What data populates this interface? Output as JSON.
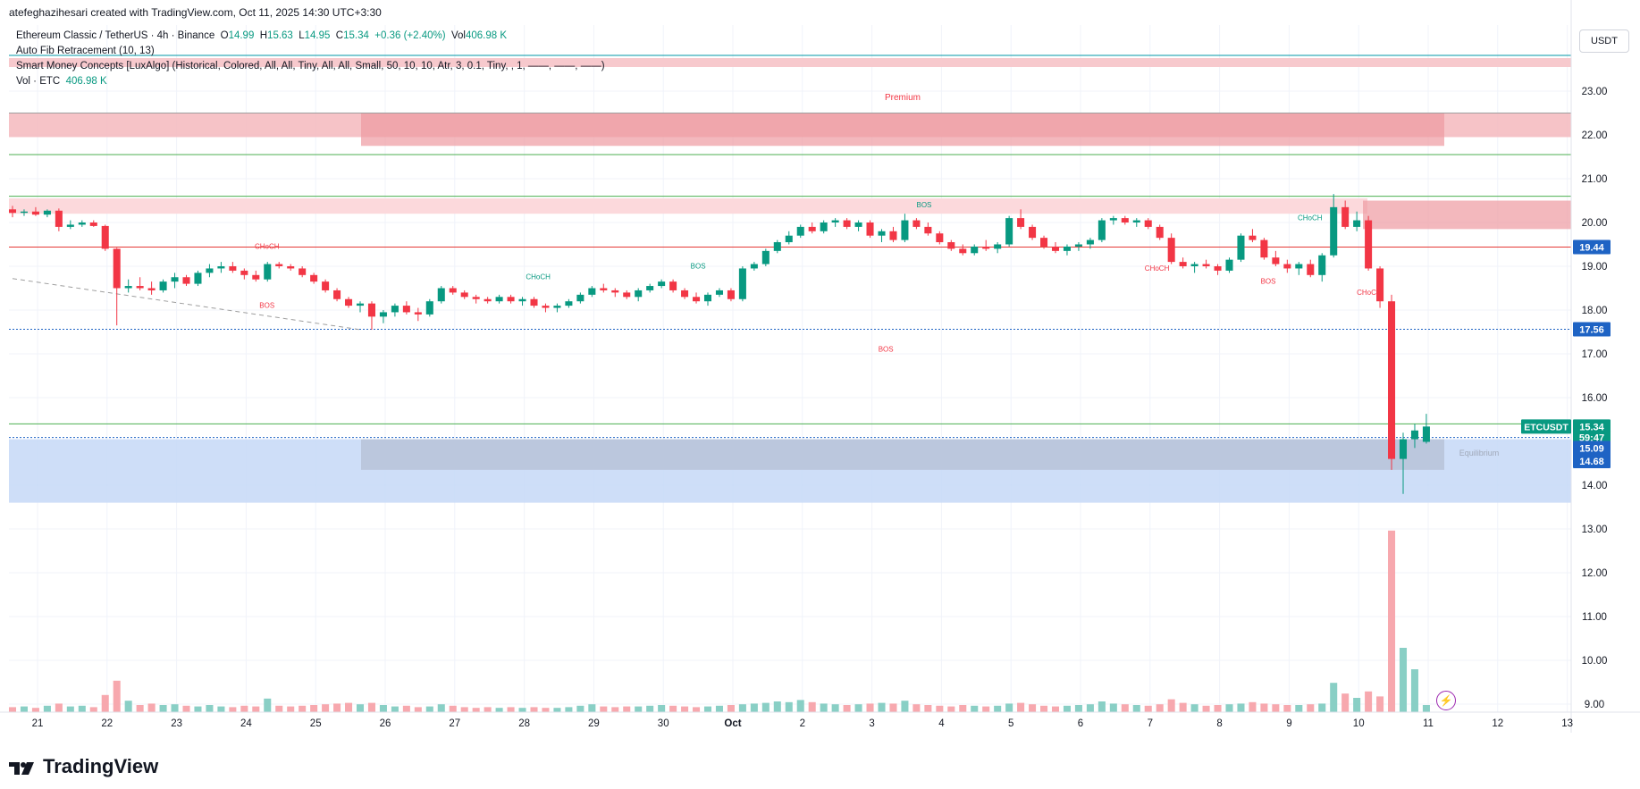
{
  "header": {
    "caption": "atefeghazihesari created with TradingView.com, Oct 11, 2025 14:30 UTC+3:30"
  },
  "legend": {
    "symbol_line": "Ethereum Classic / TetherUS · 4h · Binance",
    "o_label": "O",
    "o_value": "14.99",
    "h_label": "H",
    "h_value": "15.63",
    "l_label": "L",
    "l_value": "14.95",
    "c_label": "C",
    "c_value": "15.34",
    "change": "+0.36 (+2.40%)",
    "vol_label": "Vol",
    "vol_value": "406.98 K",
    "indicator1": "Auto Fib Retracement (10, 13)",
    "indicator2": "Smart Money Concepts [LuxAlgo] (Historical, Colored, All, All, Tiny, All, All, Small, 50, 10, 10, Atr, 3, 0.1, Tiny, , 1, ——, ——, ——)",
    "indicator3_label": "Vol · ETC",
    "indicator3_value": "406.98 K"
  },
  "currency": "USDT",
  "brand": "TradingView",
  "colors": {
    "up": "#089981",
    "down": "#f23645",
    "up_volume": "#89cfc5",
    "down_volume": "#f7a8ae",
    "premium_zone": "#f4b8bd",
    "discount_zone": "#c6d8f7",
    "fib_line": "#0097a7",
    "fib_green": "#4caf50",
    "fib_red": "#e53935",
    "fib_blue": "#1e63c4"
  },
  "chart_data": {
    "type": "candlestick",
    "symbol": "ETCUSDT",
    "timeframe": "4h",
    "y_ticks": [
      "23.00",
      "22.00",
      "21.00",
      "20.00",
      "19.00",
      "18.00",
      "17.00",
      "16.00",
      "15.00",
      "14.00",
      "13.00",
      "12.00",
      "11.00",
      "10.00",
      "9.00"
    ],
    "ylim": [
      8.75,
      24.0
    ],
    "x_ticks": [
      "21",
      "22",
      "23",
      "24",
      "25",
      "26",
      "27",
      "28",
      "29",
      "30",
      "Oct",
      "2",
      "3",
      "4",
      "5",
      "6",
      "7",
      "8",
      "9",
      "10",
      "11",
      "12",
      "13"
    ],
    "x_start": "Sep 21",
    "candles_per_day": 6,
    "price_labels": [
      {
        "text": "19.44",
        "value": 19.44,
        "color": "#1e63c4"
      },
      {
        "text": "17.56",
        "value": 17.56,
        "color": "#1e63c4"
      },
      {
        "text": "15.34",
        "value": 15.34,
        "color": "#089981"
      },
      {
        "text": "59:47",
        "value": 15.09,
        "color": "#089981"
      },
      {
        "text": "15.09",
        "value": 14.85,
        "color": "#1e63c4"
      },
      {
        "text": "14.68",
        "value": 14.55,
        "color": "#1e63c4"
      }
    ],
    "symbol_tag": "ETCUSDT",
    "zone_labels": [
      "Premium",
      "Equilibrium"
    ],
    "structure_labels": [
      {
        "text": "BOS",
        "color": "#089981",
        "x": 12.75,
        "y": 20.35
      },
      {
        "text": "BOS",
        "color": "#089981",
        "x": 9.5,
        "y": 18.95
      },
      {
        "text": "CHoCH",
        "color": "#089981",
        "x": 7.2,
        "y": 18.7
      },
      {
        "text": "CHoCH",
        "color": "#089981",
        "x": 18.3,
        "y": 20.05
      },
      {
        "text": "CHoCH",
        "color": "#f23645",
        "x": 16.1,
        "y": 18.9
      },
      {
        "text": "BOS",
        "color": "#f23645",
        "x": 17.7,
        "y": 18.6
      },
      {
        "text": "CHoCH",
        "color": "#f23645",
        "x": 19.15,
        "y": 18.35
      },
      {
        "text": "BOS",
        "color": "#f23645",
        "x": 12.2,
        "y": 17.05
      },
      {
        "text": "BOS",
        "color": "#f23645",
        "x": 3.3,
        "y": 18.05
      },
      {
        "text": "CHoCH",
        "color": "#f23645",
        "x": 3.3,
        "y": 19.4
      }
    ],
    "fib_levels": [
      {
        "value": 22.5,
        "color": "#9e9e9e"
      },
      {
        "value": 21.55,
        "color": "#4caf50"
      },
      {
        "value": 20.6,
        "color": "#4caf50"
      },
      {
        "value": 19.44,
        "color": "#e53935"
      },
      {
        "value": 17.56,
        "color": "#1e63c4"
      },
      {
        "value": 15.4,
        "color": "#4caf50"
      },
      {
        "value": 15.09,
        "color": "#1e63c4"
      }
    ],
    "ohlc": [
      [
        20.3,
        20.38,
        20.12,
        20.22
      ],
      [
        20.22,
        20.3,
        20.15,
        20.25
      ],
      [
        20.25,
        20.35,
        20.15,
        20.18
      ],
      [
        20.18,
        20.3,
        20.12,
        20.27
      ],
      [
        20.27,
        20.32,
        19.8,
        19.9
      ],
      [
        19.9,
        20.05,
        19.85,
        19.95
      ],
      [
        19.95,
        20.05,
        19.9,
        20.0
      ],
      [
        20.0,
        20.05,
        19.9,
        19.92
      ],
      [
        19.92,
        19.95,
        19.35,
        19.4
      ],
      [
        19.4,
        19.42,
        17.65,
        18.5
      ],
      [
        18.5,
        18.7,
        18.4,
        18.55
      ],
      [
        18.55,
        18.75,
        18.45,
        18.5
      ],
      [
        18.5,
        18.65,
        18.35,
        18.45
      ],
      [
        18.45,
        18.7,
        18.4,
        18.65
      ],
      [
        18.65,
        18.85,
        18.5,
        18.75
      ],
      [
        18.75,
        18.8,
        18.55,
        18.6
      ],
      [
        18.6,
        18.9,
        18.55,
        18.85
      ],
      [
        18.85,
        19.05,
        18.75,
        18.95
      ],
      [
        18.95,
        19.1,
        18.85,
        19.0
      ],
      [
        19.0,
        19.1,
        18.85,
        18.9
      ],
      [
        18.9,
        18.95,
        18.7,
        18.8
      ],
      [
        18.8,
        18.9,
        18.65,
        18.7
      ],
      [
        18.7,
        19.1,
        18.65,
        19.05
      ],
      [
        19.05,
        19.1,
        18.95,
        19.0
      ],
      [
        19.0,
        19.05,
        18.9,
        18.95
      ],
      [
        18.95,
        19.0,
        18.75,
        18.8
      ],
      [
        18.8,
        18.85,
        18.6,
        18.65
      ],
      [
        18.65,
        18.7,
        18.4,
        18.45
      ],
      [
        18.45,
        18.5,
        18.2,
        18.25
      ],
      [
        18.25,
        18.3,
        18.05,
        18.1
      ],
      [
        18.1,
        18.2,
        17.95,
        18.15
      ],
      [
        18.15,
        18.2,
        17.55,
        17.85
      ],
      [
        17.85,
        18.0,
        17.7,
        17.95
      ],
      [
        17.95,
        18.15,
        17.85,
        18.1
      ],
      [
        18.1,
        18.2,
        17.9,
        17.95
      ],
      [
        17.95,
        18.05,
        17.75,
        17.9
      ],
      [
        17.9,
        18.25,
        17.85,
        18.2
      ],
      [
        18.2,
        18.55,
        18.15,
        18.5
      ],
      [
        18.5,
        18.55,
        18.35,
        18.4
      ],
      [
        18.4,
        18.45,
        18.25,
        18.3
      ],
      [
        18.3,
        18.35,
        18.15,
        18.25
      ],
      [
        18.25,
        18.3,
        18.15,
        18.2
      ],
      [
        18.2,
        18.35,
        18.15,
        18.3
      ],
      [
        18.3,
        18.35,
        18.15,
        18.2
      ],
      [
        18.2,
        18.3,
        18.1,
        18.25
      ],
      [
        18.25,
        18.3,
        18.05,
        18.1
      ],
      [
        18.1,
        18.15,
        17.95,
        18.05
      ],
      [
        18.05,
        18.15,
        17.95,
        18.1
      ],
      [
        18.1,
        18.25,
        18.05,
        18.2
      ],
      [
        18.2,
        18.4,
        18.15,
        18.35
      ],
      [
        18.35,
        18.55,
        18.3,
        18.5
      ],
      [
        18.5,
        18.6,
        18.4,
        18.45
      ],
      [
        18.45,
        18.5,
        18.3,
        18.4
      ],
      [
        18.4,
        18.45,
        18.25,
        18.3
      ],
      [
        18.3,
        18.5,
        18.2,
        18.45
      ],
      [
        18.45,
        18.6,
        18.4,
        18.55
      ],
      [
        18.55,
        18.7,
        18.5,
        18.65
      ],
      [
        18.65,
        18.7,
        18.4,
        18.45
      ],
      [
        18.45,
        18.5,
        18.25,
        18.3
      ],
      [
        18.3,
        18.4,
        18.15,
        18.2
      ],
      [
        18.2,
        18.4,
        18.1,
        18.35
      ],
      [
        18.35,
        18.5,
        18.3,
        18.45
      ],
      [
        18.45,
        18.5,
        18.2,
        18.25
      ],
      [
        18.25,
        19.0,
        18.2,
        18.95
      ],
      [
        18.95,
        19.1,
        18.9,
        19.05
      ],
      [
        19.05,
        19.4,
        19.0,
        19.35
      ],
      [
        19.35,
        19.6,
        19.3,
        19.55
      ],
      [
        19.55,
        19.8,
        19.5,
        19.7
      ],
      [
        19.7,
        19.95,
        19.65,
        19.9
      ],
      [
        19.9,
        20.0,
        19.75,
        19.8
      ],
      [
        19.8,
        20.05,
        19.75,
        20.0
      ],
      [
        20.0,
        20.1,
        19.9,
        20.05
      ],
      [
        20.05,
        20.1,
        19.85,
        19.9
      ],
      [
        19.9,
        20.05,
        19.8,
        20.0
      ],
      [
        20.0,
        20.05,
        19.65,
        19.7
      ],
      [
        19.7,
        19.85,
        19.55,
        19.8
      ],
      [
        19.8,
        19.9,
        19.55,
        19.6
      ],
      [
        19.6,
        20.2,
        19.55,
        20.05
      ],
      [
        20.05,
        20.1,
        19.85,
        19.9
      ],
      [
        19.9,
        20.0,
        19.7,
        19.75
      ],
      [
        19.75,
        19.8,
        19.5,
        19.55
      ],
      [
        19.55,
        19.6,
        19.35,
        19.4
      ],
      [
        19.4,
        19.5,
        19.25,
        19.3
      ],
      [
        19.3,
        19.5,
        19.25,
        19.45
      ],
      [
        19.45,
        19.6,
        19.35,
        19.4
      ],
      [
        19.4,
        19.55,
        19.3,
        19.5
      ],
      [
        19.5,
        20.15,
        19.45,
        20.1
      ],
      [
        20.1,
        20.3,
        19.85,
        19.9
      ],
      [
        19.9,
        19.95,
        19.6,
        19.65
      ],
      [
        19.65,
        19.7,
        19.4,
        19.45
      ],
      [
        19.45,
        19.55,
        19.3,
        19.35
      ],
      [
        19.35,
        19.5,
        19.25,
        19.45
      ],
      [
        19.45,
        19.55,
        19.35,
        19.5
      ],
      [
        19.5,
        19.65,
        19.4,
        19.6
      ],
      [
        19.6,
        20.1,
        19.55,
        20.05
      ],
      [
        20.05,
        20.15,
        19.95,
        20.1
      ],
      [
        20.1,
        20.15,
        19.95,
        20.0
      ],
      [
        20.0,
        20.1,
        19.9,
        20.05
      ],
      [
        20.05,
        20.1,
        19.85,
        19.9
      ],
      [
        19.9,
        19.95,
        19.6,
        19.65
      ],
      [
        19.65,
        19.75,
        19.05,
        19.1
      ],
      [
        19.1,
        19.2,
        18.95,
        19.0
      ],
      [
        19.0,
        19.1,
        18.85,
        19.05
      ],
      [
        19.05,
        19.15,
        18.95,
        19.0
      ],
      [
        19.0,
        19.05,
        18.8,
        18.9
      ],
      [
        18.9,
        19.2,
        18.85,
        19.15
      ],
      [
        19.15,
        19.75,
        19.1,
        19.7
      ],
      [
        19.7,
        19.85,
        19.55,
        19.6
      ],
      [
        19.6,
        19.65,
        19.15,
        19.2
      ],
      [
        19.2,
        19.35,
        19.0,
        19.05
      ],
      [
        19.05,
        19.15,
        18.85,
        18.95
      ],
      [
        18.95,
        19.1,
        18.8,
        19.05
      ],
      [
        19.05,
        19.15,
        18.75,
        18.8
      ],
      [
        18.8,
        19.3,
        18.65,
        19.25
      ],
      [
        19.25,
        20.65,
        19.2,
        20.35
      ],
      [
        20.35,
        20.5,
        19.85,
        19.9
      ],
      [
        19.9,
        20.25,
        19.8,
        20.05
      ],
      [
        20.05,
        20.15,
        18.9,
        18.95
      ],
      [
        18.95,
        19.0,
        18.05,
        18.2
      ],
      [
        18.2,
        18.35,
        14.35,
        14.6
      ],
      [
        14.6,
        15.2,
        13.8,
        15.05
      ],
      [
        15.05,
        15.4,
        14.85,
        15.25
      ],
      [
        14.99,
        15.63,
        14.95,
        15.34
      ]
    ],
    "volume": [
      0.35,
      0.4,
      0.3,
      0.45,
      0.6,
      0.4,
      0.45,
      0.35,
      1.2,
      2.2,
      0.8,
      0.5,
      0.6,
      0.5,
      0.55,
      0.45,
      0.4,
      0.5,
      0.4,
      0.35,
      0.45,
      0.4,
      0.95,
      0.45,
      0.4,
      0.45,
      0.5,
      0.55,
      0.6,
      0.65,
      0.55,
      0.65,
      0.5,
      0.4,
      0.45,
      0.35,
      0.4,
      0.55,
      0.45,
      0.35,
      0.3,
      0.35,
      0.3,
      0.35,
      0.3,
      0.35,
      0.3,
      0.3,
      0.35,
      0.45,
      0.55,
      0.4,
      0.35,
      0.4,
      0.4,
      0.45,
      0.5,
      0.45,
      0.4,
      0.35,
      0.4,
      0.45,
      0.5,
      0.55,
      0.6,
      0.65,
      0.75,
      0.7,
      0.85,
      0.7,
      0.6,
      0.55,
      0.5,
      0.55,
      0.6,
      0.65,
      0.6,
      0.8,
      0.55,
      0.5,
      0.45,
      0.4,
      0.5,
      0.45,
      0.4,
      0.45,
      0.6,
      0.65,
      0.55,
      0.45,
      0.4,
      0.45,
      0.5,
      0.55,
      0.75,
      0.6,
      0.55,
      0.5,
      0.45,
      0.55,
      0.9,
      0.65,
      0.55,
      0.45,
      0.5,
      0.55,
      0.6,
      0.7,
      0.6,
      0.55,
      0.5,
      0.5,
      0.55,
      0.6,
      2.05,
      1.3,
      1.0,
      1.45,
      1.1,
      12.7,
      4.5,
      3.0,
      0.5
    ]
  }
}
